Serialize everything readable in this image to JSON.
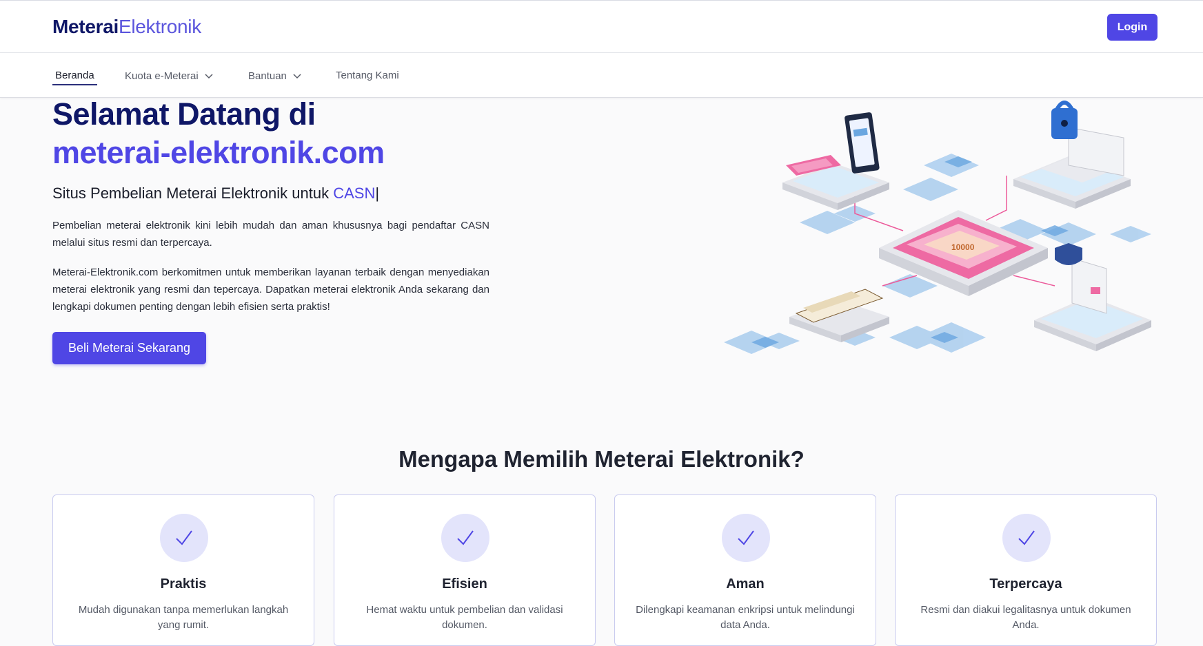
{
  "header": {
    "brand_part1": "Meterai",
    "brand_part2": "Elektronik",
    "login_label": "Login"
  },
  "nav": {
    "items": [
      {
        "label": "Beranda",
        "active": true
      },
      {
        "label": "Kuota e-Meterai",
        "dropdown": true
      },
      {
        "label": "Bantuan",
        "dropdown": true
      },
      {
        "label": "Tentang Kami"
      }
    ]
  },
  "hero": {
    "title_line1": "Selamat Datang di",
    "title_line2": "meterai-elektronik.com",
    "subtitle_prefix": "Situs Pembelian Meterai Elektronik untuk ",
    "subtitle_accent": "CASN",
    "subtitle_cursor": "|",
    "paragraph1": "Pembelian meterai elektronik kini lebih mudah dan aman khususnya bagi pendaftar CASN melalui situs resmi dan terpercaya.",
    "paragraph2": "Meterai-Elektronik.com berkomitmen untuk memberikan layanan terbaik dengan menyediakan meterai elektronik yang resmi dan tepercaya. Dapatkan meterai elektronik Anda sekarang dan lengkapi dokumen penting dengan lebih efisien serta praktis!",
    "cta_label": "Beli Meterai Sekarang"
  },
  "why": {
    "title": "Mengapa Memilih Meterai Elektronik?",
    "cards": [
      {
        "title": "Praktis",
        "desc": "Mudah digunakan tanpa memerlukan langkah yang rumit."
      },
      {
        "title": "Efisien",
        "desc": "Hemat waktu untuk pembelian dan validasi dokumen."
      },
      {
        "title": "Aman",
        "desc": "Dilengkapi keamanan enkripsi untuk melindungi data Anda."
      },
      {
        "title": "Terpercaya",
        "desc": "Resmi dan diakui legalitasnya untuk dokumen Anda."
      }
    ]
  },
  "colors": {
    "brand_dark": "#0f1767",
    "accent": "#4f46e5",
    "background": "#fafafb",
    "check_bg": "#e3e4fb"
  },
  "icons": {
    "nav_dropdown": "chevron-down-icon",
    "card": "check-icon"
  }
}
